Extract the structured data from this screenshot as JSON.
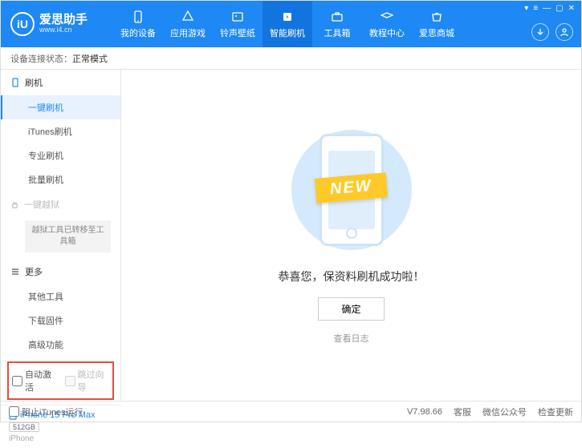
{
  "header": {
    "logo_text": "iU",
    "title": "爱思助手",
    "subtitle": "www.i4.cn",
    "nav": [
      {
        "label": "我的设备"
      },
      {
        "label": "应用游戏"
      },
      {
        "label": "铃声壁纸"
      },
      {
        "label": "智能刷机"
      },
      {
        "label": "工具箱"
      },
      {
        "label": "教程中心"
      },
      {
        "label": "爱思商城"
      }
    ],
    "window_controls": [
      "▾",
      "≡",
      "—",
      "▢",
      "✕"
    ]
  },
  "status": {
    "label": "设备连接状态：",
    "value": "正常模式"
  },
  "sidebar": {
    "flash_heading": "刷机",
    "flash_items": [
      {
        "label": "一键刷机"
      },
      {
        "label": "iTunes刷机"
      },
      {
        "label": "专业刷机"
      },
      {
        "label": "批量刷机"
      }
    ],
    "jailbreak_heading": "一键越狱",
    "jailbreak_note": "越狱工具已转移至工具箱",
    "more_heading": "更多",
    "more_items": [
      {
        "label": "其他工具"
      },
      {
        "label": "下载固件"
      },
      {
        "label": "高级功能"
      }
    ],
    "checkbox1": "自动激活",
    "checkbox2": "跳过向导",
    "device_name": "iPhone 15 Pro Max",
    "device_storage": "512GB",
    "device_type": "iPhone"
  },
  "main": {
    "ribbon": "NEW",
    "success_text": "恭喜您，保资料刷机成功啦！",
    "ok_button": "确定",
    "view_log": "查看日志"
  },
  "footer": {
    "block_itunes": "阻止iTunes运行",
    "version": "V7.98.66",
    "links": [
      "客服",
      "微信公众号",
      "检查更新"
    ]
  }
}
